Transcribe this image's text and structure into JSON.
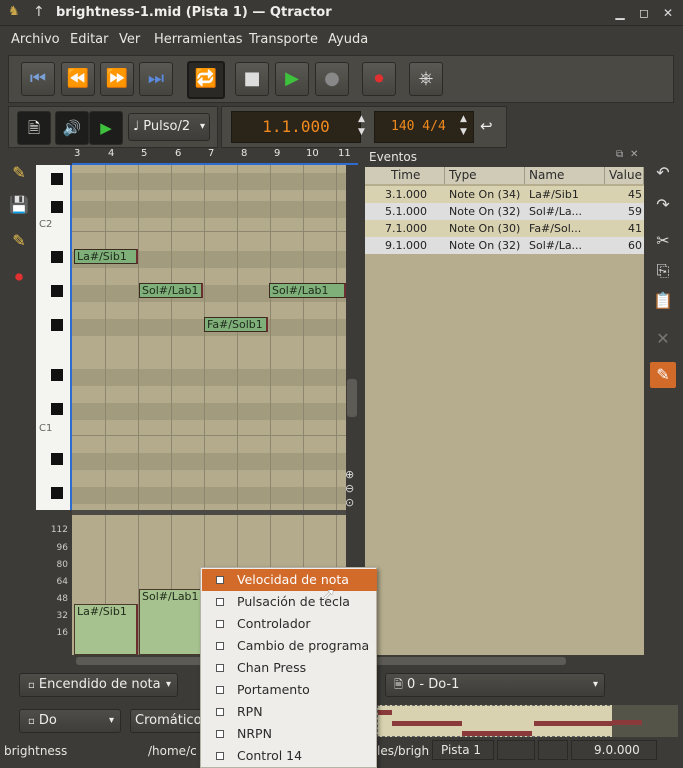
{
  "window": {
    "title": "brightness-1.mid (Pista 1) — Qtractor"
  },
  "menu": [
    "Archivo",
    "Editar",
    "Ver",
    "Herramientas",
    "Transporte",
    "Ayuda"
  ],
  "toolbar": {
    "snap_value": "Pulso/2",
    "time_display": "1.1.000",
    "tempo_display": "140 4/4"
  },
  "ruler": {
    "labels": [
      "3",
      "4",
      "5",
      "6",
      "7",
      "8",
      "9",
      "10",
      "11"
    ]
  },
  "piano": {
    "octave_labels": [
      "C2",
      "C1"
    ]
  },
  "notes": [
    {
      "label": "La#/Sib1"
    },
    {
      "label": "Sol#/Lab1"
    },
    {
      "label": "Fa#/Solb1"
    },
    {
      "label": "Sol#/Lab1"
    }
  ],
  "velocity": {
    "ticks": [
      "112",
      "96",
      "80",
      "64",
      "48",
      "32",
      "16"
    ],
    "bars": [
      {
        "label": "La#/Sib1"
      },
      {
        "label": "Sol#/Lab1"
      }
    ]
  },
  "events": {
    "title": "Eventos",
    "columns": [
      "Time",
      "Type",
      "Name",
      "Value"
    ],
    "rows": [
      {
        "time": "3.1.000",
        "type": "Note On (34)",
        "name": "La#/Sib1",
        "value": "45"
      },
      {
        "time": "5.1.000",
        "type": "Note On (32)",
        "name": "Sol#/La...",
        "value": "59"
      },
      {
        "time": "7.1.000",
        "type": "Note On (30)",
        "name": "Fa#/Sol...",
        "value": "41"
      },
      {
        "time": "9.1.000",
        "type": "Note On (32)",
        "name": "Sol#/La...",
        "value": "60"
      }
    ]
  },
  "controls": {
    "event_type": "Encendido de nota",
    "key": "Do",
    "scale": "Cromático",
    "instrument": "0 - Do-1"
  },
  "context_menu": {
    "items": [
      "Velocidad de nota",
      "Pulsación de tecla",
      "Controlador",
      "Cambio de programa",
      "Chan Press",
      "Portamento",
      "RPN",
      "NRPN",
      "Control 14"
    ]
  },
  "statusbar": {
    "name": "brightness",
    "path_start": "/home/c",
    "path_end": "les/brigh",
    "track": "Pista 1",
    "length": "9.0.000"
  }
}
